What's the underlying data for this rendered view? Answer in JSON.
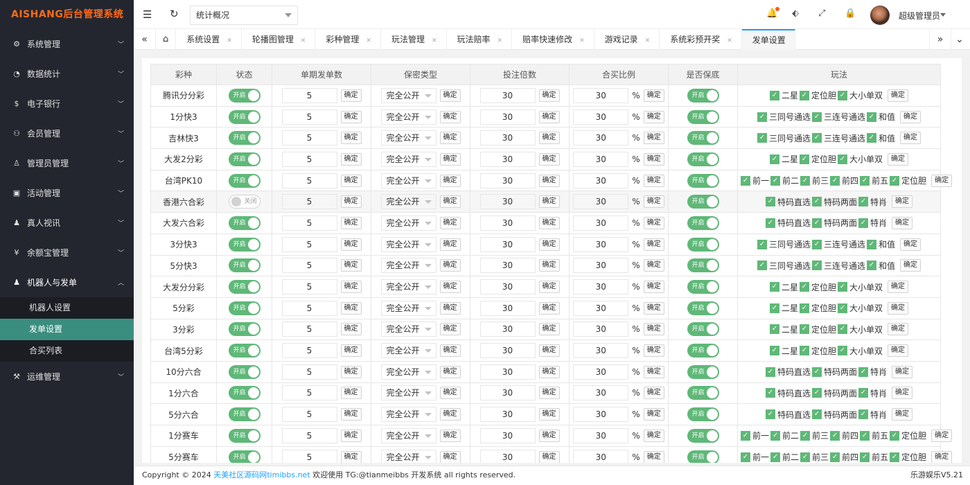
{
  "logo": "AISHANG后台管理系统",
  "sidebar": {
    "items": [
      {
        "icon": "⚙",
        "label": "系统管理"
      },
      {
        "icon": "◔",
        "label": "数据统计"
      },
      {
        "icon": "$",
        "label": "电子银行"
      },
      {
        "icon": "⚇",
        "label": "会员管理"
      },
      {
        "icon": "♙",
        "label": "管理员管理"
      },
      {
        "icon": "▣",
        "label": "活动管理"
      },
      {
        "icon": "♟",
        "label": "真人视讯"
      },
      {
        "icon": "¥",
        "label": "余额宝管理"
      },
      {
        "icon": "♟",
        "label": "机器人与发单"
      }
    ],
    "sub_items": [
      "机器人设置",
      "发单设置",
      "合买列表"
    ],
    "last_item": {
      "icon": "⚒",
      "label": "运维管理"
    }
  },
  "header": {
    "select_value": "统计概况",
    "username": "超级管理员"
  },
  "tabs": [
    "系统设置",
    "轮播图管理",
    "彩种管理",
    "玩法管理",
    "玩法赔率",
    "赔率快速修改",
    "游戏记录",
    "系统彩预开奖",
    "发单设置"
  ],
  "table": {
    "headers": [
      "彩种",
      "状态",
      "单期发单数",
      "保密类型",
      "投注倍数",
      "合买比例",
      "是否保底",
      "玩法"
    ],
    "confirm_label": "确定",
    "on_label": "开启",
    "off_label": "关闭",
    "percent": "%",
    "rows": [
      {
        "name": "腾讯分分彩",
        "status": "开启",
        "count": "5",
        "secret": "完全公开",
        "multiple": "30",
        "ratio": "30",
        "plays": [
          "二星",
          "定位胆",
          "大小单双"
        ]
      },
      {
        "name": "1分快3",
        "status": "开启",
        "count": "5",
        "secret": "完全公开",
        "multiple": "30",
        "ratio": "30",
        "plays": [
          "三同号通选",
          "三连号通选",
          "和值"
        ]
      },
      {
        "name": "吉林快3",
        "status": "开启",
        "count": "5",
        "secret": "完全公开",
        "multiple": "30",
        "ratio": "30",
        "plays": [
          "三同号通选",
          "三连号通选",
          "和值"
        ]
      },
      {
        "name": "大发2分彩",
        "status": "开启",
        "count": "5",
        "secret": "完全公开",
        "multiple": "30",
        "ratio": "30",
        "plays": [
          "二星",
          "定位胆",
          "大小单双"
        ]
      },
      {
        "name": "台湾PK10",
        "status": "开启",
        "count": "5",
        "secret": "完全公开",
        "multiple": "30",
        "ratio": "30",
        "plays": [
          "前一",
          "前二",
          "前三",
          "前四",
          "前五",
          "定位胆"
        ]
      },
      {
        "name": "香港六合彩",
        "status": "关闭",
        "count": "5",
        "secret": "完全公开",
        "multiple": "30",
        "ratio": "30",
        "plays": [
          "特码直选",
          "特码两面",
          "特肖"
        ]
      },
      {
        "name": "大发六合彩",
        "status": "开启",
        "count": "5",
        "secret": "完全公开",
        "multiple": "30",
        "ratio": "30",
        "plays": [
          "特码直选",
          "特码两面",
          "特肖"
        ]
      },
      {
        "name": "3分快3",
        "status": "开启",
        "count": "5",
        "secret": "完全公开",
        "multiple": "30",
        "ratio": "30",
        "plays": [
          "三同号通选",
          "三连号通选",
          "和值"
        ]
      },
      {
        "name": "5分快3",
        "status": "开启",
        "count": "5",
        "secret": "完全公开",
        "multiple": "30",
        "ratio": "30",
        "plays": [
          "三同号通选",
          "三连号通选",
          "和值"
        ]
      },
      {
        "name": "大发分分彩",
        "status": "开启",
        "count": "5",
        "secret": "完全公开",
        "multiple": "30",
        "ratio": "30",
        "plays": [
          "二星",
          "定位胆",
          "大小单双"
        ]
      },
      {
        "name": "5分彩",
        "status": "开启",
        "count": "5",
        "secret": "完全公开",
        "multiple": "30",
        "ratio": "30",
        "plays": [
          "二星",
          "定位胆",
          "大小单双"
        ]
      },
      {
        "name": "3分彩",
        "status": "开启",
        "count": "5",
        "secret": "完全公开",
        "multiple": "30",
        "ratio": "30",
        "plays": [
          "二星",
          "定位胆",
          "大小单双"
        ]
      },
      {
        "name": "台湾5分彩",
        "status": "开启",
        "count": "5",
        "secret": "完全公开",
        "multiple": "30",
        "ratio": "30",
        "plays": [
          "二星",
          "定位胆",
          "大小单双"
        ]
      },
      {
        "name": "10分六合",
        "status": "开启",
        "count": "5",
        "secret": "完全公开",
        "multiple": "30",
        "ratio": "30",
        "plays": [
          "特码直选",
          "特码两面",
          "特肖"
        ]
      },
      {
        "name": "1分六合",
        "status": "开启",
        "count": "5",
        "secret": "完全公开",
        "multiple": "30",
        "ratio": "30",
        "plays": [
          "特码直选",
          "特码两面",
          "特肖"
        ]
      },
      {
        "name": "5分六合",
        "status": "开启",
        "count": "5",
        "secret": "完全公开",
        "multiple": "30",
        "ratio": "30",
        "plays": [
          "特码直选",
          "特码两面",
          "特肖"
        ]
      },
      {
        "name": "1分赛车",
        "status": "开启",
        "count": "5",
        "secret": "完全公开",
        "multiple": "30",
        "ratio": "30",
        "plays": [
          "前一",
          "前二",
          "前三",
          "前四",
          "前五",
          "定位胆"
        ]
      },
      {
        "name": "5分赛车",
        "status": "开启",
        "count": "5",
        "secret": "完全公开",
        "multiple": "30",
        "ratio": "30",
        "plays": [
          "前一",
          "前二",
          "前三",
          "前四",
          "前五",
          "定位胆"
        ]
      }
    ]
  },
  "footer": {
    "prefix": "Copyright © 2024",
    "link": "天美社区源码网timibbs.net",
    "suffix": "欢迎使用 TG:@tianmeibbs 开发系统 all rights reserved.",
    "version": "乐游娱乐V5.21"
  },
  "colors": {
    "accent": "#5fb878",
    "active_menu": "#3a8e7f",
    "sidebar": "#23262e",
    "link": "#1e9fff"
  }
}
